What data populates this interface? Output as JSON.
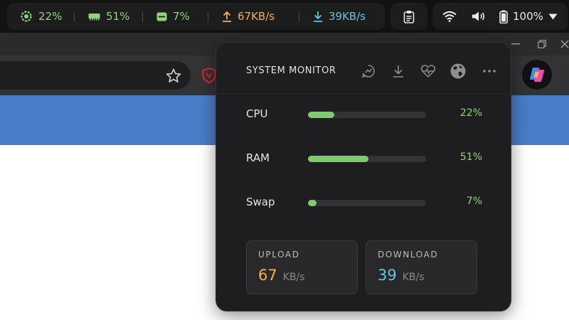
{
  "panel": {
    "cpu": "22%",
    "ram": "51%",
    "swap": "7%",
    "upload": "67KB/s",
    "download": "39KB/s",
    "battery": "100%",
    "icons": [
      "cpu-chip-icon",
      "ram-icon",
      "swap-icon",
      "upload-arrow-icon",
      "download-arrow-icon",
      "clipboard-icon",
      "wifi-icon",
      "volume-icon",
      "battery-icon",
      "caret-down-icon"
    ]
  },
  "popup": {
    "title": "SYSTEM MONITOR",
    "header_icons": [
      "chart-icon",
      "download-icon",
      "heartbeat-icon",
      "globe-icon",
      "more-icon"
    ],
    "metrics": [
      {
        "label": "CPU",
        "percent": "22%",
        "value": 22
      },
      {
        "label": "RAM",
        "percent": "51%",
        "value": 51
      },
      {
        "label": "Swap",
        "percent": "7%",
        "value": 7
      }
    ],
    "upload": {
      "label": "UPLOAD",
      "value": "67",
      "unit": "KB/s"
    },
    "download": {
      "label": "DOWNLOAD",
      "value": "39",
      "unit": "KB/s"
    }
  },
  "browser": {
    "icons": [
      "star-icon",
      "shield-icon",
      "copilot-icon",
      "minimize-icon",
      "restore-icon",
      "close-icon"
    ]
  },
  "colors": {
    "accent_green": "#8fd47c",
    "upload": "#f5b14b",
    "download": "#5cc8e6",
    "banner_blue": "#4a7cc7"
  }
}
